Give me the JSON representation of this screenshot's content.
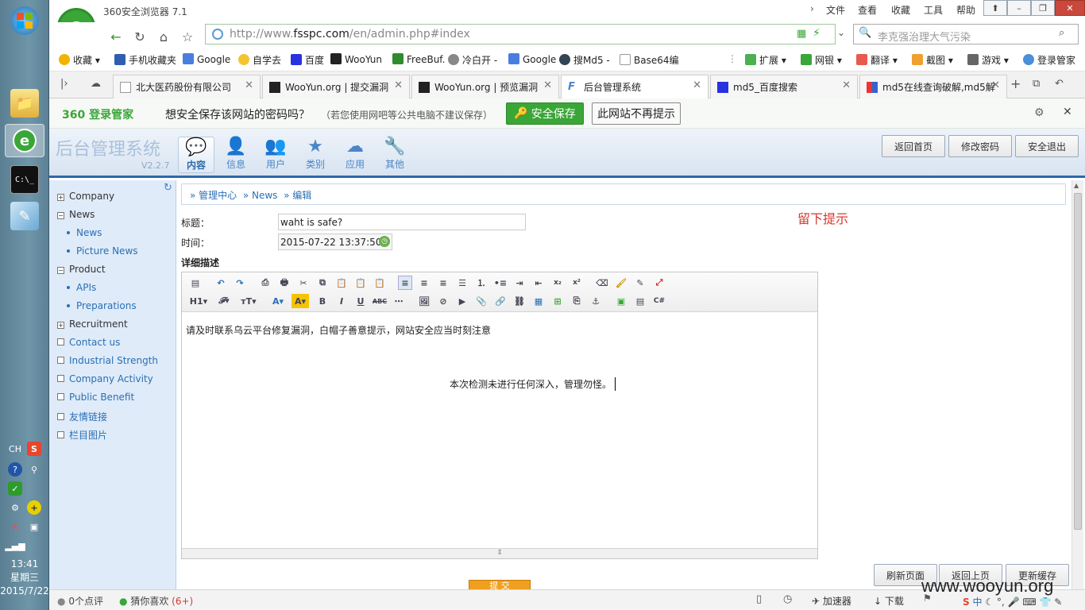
{
  "taskbar": {
    "time": "13:41",
    "weekday": "星期三",
    "date": "2015/7/22",
    "lang": "CH"
  },
  "browser": {
    "title": "360安全浏览器 7.1",
    "menu": [
      "文件",
      "查看",
      "收藏",
      "工具",
      "帮助"
    ],
    "url_prefix": "http://www.",
    "url_domain": "fsspc.com",
    "url_path": "/en/admin.php#index",
    "search_text": "李克强治理大气污染",
    "bookmarks": [
      {
        "label": "收藏",
        "color": "#f0b400"
      },
      {
        "label": "手机收藏夹",
        "color": "#2f5fb0"
      },
      {
        "label": "Google",
        "color": "#4a7de0"
      },
      {
        "label": "自学去",
        "color": "#f4c430"
      },
      {
        "label": "百度",
        "color": "#2932e1"
      },
      {
        "label": "WooYun",
        "color": "#222222"
      },
      {
        "label": "FreeBuf.",
        "color": "#2e8b2e"
      },
      {
        "label": "冷白开 -",
        "color": "#888888"
      },
      {
        "label": "Google",
        "color": "#4a7de0"
      },
      {
        "label": "搜Md5 -",
        "color": "#334455"
      },
      {
        "label": "Base64编",
        "color": "#999999"
      }
    ],
    "bookmarks_right": [
      "扩展",
      "网银",
      "翻译",
      "截图",
      "游戏",
      "登录管家"
    ],
    "tabs": [
      {
        "label": "北大医药股份有限公司",
        "active": false
      },
      {
        "label": "WooYun.org | 提交漏洞",
        "active": false
      },
      {
        "label": "WooYun.org | 预览漏洞",
        "active": false
      },
      {
        "label": "后台管理系统",
        "active": true
      },
      {
        "label": "md5_百度搜索",
        "active": false
      },
      {
        "label": "md5在线查询破解,md5解",
        "active": false
      }
    ]
  },
  "password_bar": {
    "brand": "360 登录管家",
    "question": "想安全保存该网站的密码吗？",
    "hint": "（若您使用网吧等公共电脑不建议保存）",
    "save_label": "安全保存",
    "never_label": "此网站不再提示"
  },
  "admin": {
    "title": "后台管理系统",
    "version": "V2.2.7",
    "nav": [
      {
        "label": "内容",
        "icon": "chat-icon",
        "active": true
      },
      {
        "label": "信息",
        "icon": "user-icon",
        "active": false
      },
      {
        "label": "用户",
        "icon": "users-icon",
        "active": false
      },
      {
        "label": "类别",
        "icon": "star-icon",
        "active": false
      },
      {
        "label": "应用",
        "icon": "cloud-icon",
        "active": false
      },
      {
        "label": "其他",
        "icon": "wrench-icon",
        "active": false
      }
    ],
    "header_buttons": [
      "返回首页",
      "修改密码",
      "安全退出"
    ],
    "sidebar": [
      {
        "label": "Company",
        "type": "group",
        "open": false
      },
      {
        "label": "News",
        "type": "group",
        "open": true
      },
      {
        "label": "News",
        "type": "sub"
      },
      {
        "label": "Picture News",
        "type": "sub"
      },
      {
        "label": "Product",
        "type": "group",
        "open": true
      },
      {
        "label": "APIs",
        "type": "sub"
      },
      {
        "label": "Preparations",
        "type": "sub"
      },
      {
        "label": "Recruitment",
        "type": "group",
        "open": false
      },
      {
        "label": "Contact us",
        "type": "leaf"
      },
      {
        "label": "Industrial Strength",
        "type": "leaf"
      },
      {
        "label": "Company Activity",
        "type": "leaf"
      },
      {
        "label": "Public Benefit",
        "type": "leaf"
      },
      {
        "label": "友情链接",
        "type": "leaf"
      },
      {
        "label": "栏目图片",
        "type": "leaf"
      }
    ],
    "breadcrumb": [
      "管理中心",
      "News",
      "编辑"
    ],
    "form": {
      "title_label": "标题：",
      "title_value": "waht is safe?",
      "time_label": "时间：",
      "time_value": "2015-07-22 13:37:50",
      "desc_label": "详细描述",
      "note": "留下提示"
    },
    "editor": {
      "line1": "请及时联系乌云平台修复漏洞，白帽子善意提示，网站安全应当时刻注意",
      "line2": "本次检测未进行任何深入，管理勿怪。"
    },
    "submit_label": "提 交",
    "bottom_buttons": [
      "刷新页面",
      "返回上页",
      "更新缓存"
    ]
  },
  "status": {
    "comments": "0个点评",
    "recommend": "猜你喜欢",
    "recommend_count": "(6+)",
    "accelerator": "加速器",
    "download": "下载",
    "watermark": "www.wooyun.org"
  },
  "colors": {
    "brand_green": "#3aa637",
    "admin_blue": "#2d69a8",
    "sidebar_bg": "#dfebf8",
    "note_red": "#d9372b"
  }
}
